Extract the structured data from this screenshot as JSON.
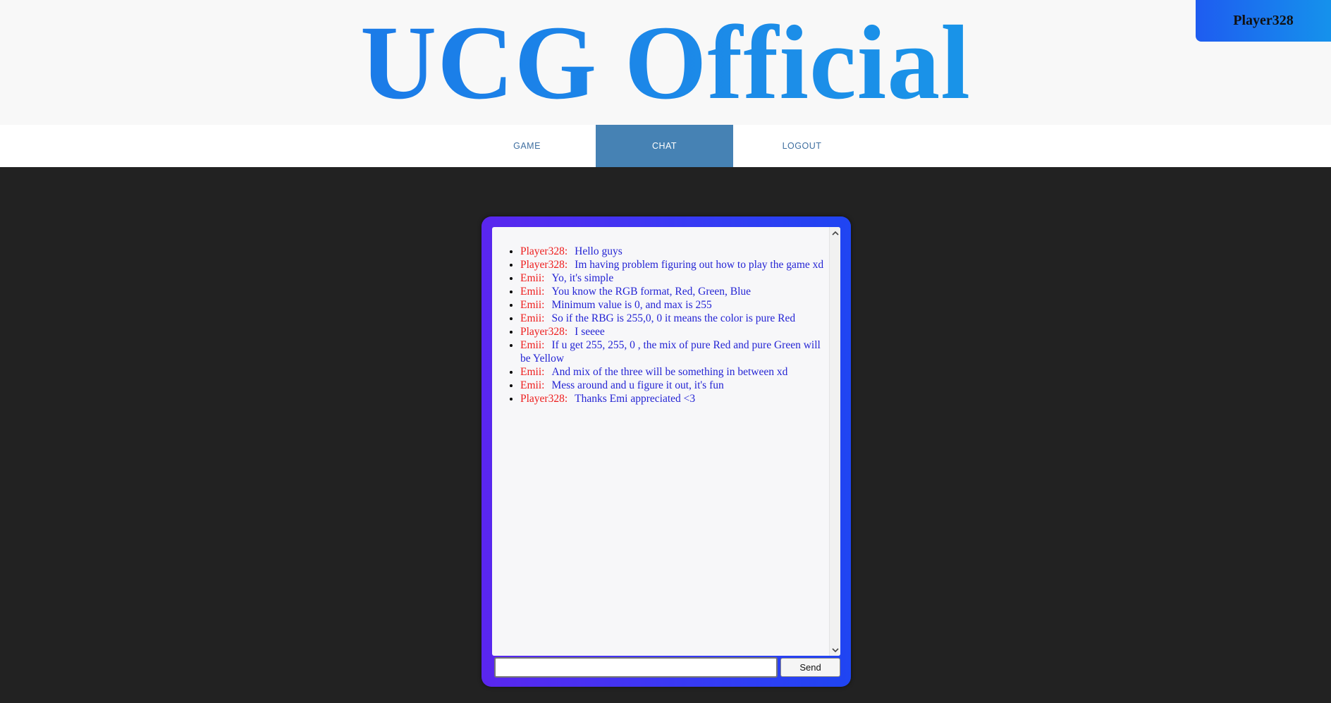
{
  "header": {
    "site_title": "UCG Official",
    "user_badge": "Player328"
  },
  "nav": {
    "items": [
      {
        "label": "GAME",
        "active": false
      },
      {
        "label": "CHAT",
        "active": true
      },
      {
        "label": "LOGOUT",
        "active": false
      }
    ]
  },
  "chat": {
    "messages": [
      {
        "sender": "Player328:",
        "text": "Hello guys"
      },
      {
        "sender": "Player328:",
        "text": "Im having problem figuring out how to play the game xd"
      },
      {
        "sender": "Emii:",
        "text": "Yo, it's simple"
      },
      {
        "sender": "Emii:",
        "text": "You know the RGB format, Red, Green, Blue"
      },
      {
        "sender": "Emii:",
        "text": "Minimum value is 0, and max is 255"
      },
      {
        "sender": "Emii:",
        "text": "So if the RBG is 255,0, 0 it means the color is pure Red"
      },
      {
        "sender": "Player328:",
        "text": "I seeee"
      },
      {
        "sender": "Emii:",
        "text": "If u get 255, 255, 0 , the mix of pure Red and pure Green will be Yellow"
      },
      {
        "sender": "Emii:",
        "text": "And mix of the three will be something in between xd"
      },
      {
        "sender": "Emii:",
        "text": "Mess around and u figure it out, it's fun"
      },
      {
        "sender": "Player328:",
        "text": "Thanks Emi appreciated <3"
      }
    ],
    "input_value": "",
    "send_label": "Send"
  },
  "icons": {
    "scroll_up": "chevron-up-icon",
    "scroll_down": "chevron-down-icon"
  },
  "colors": {
    "background": "#222222",
    "header_bg": "#f8f8f8",
    "nav_active_bg": "#4682b4",
    "sender_color": "#ee1c1c",
    "message_color": "#2424d4",
    "panel_gradient_start": "#5a26ee",
    "panel_gradient_end": "#1f45f2"
  }
}
